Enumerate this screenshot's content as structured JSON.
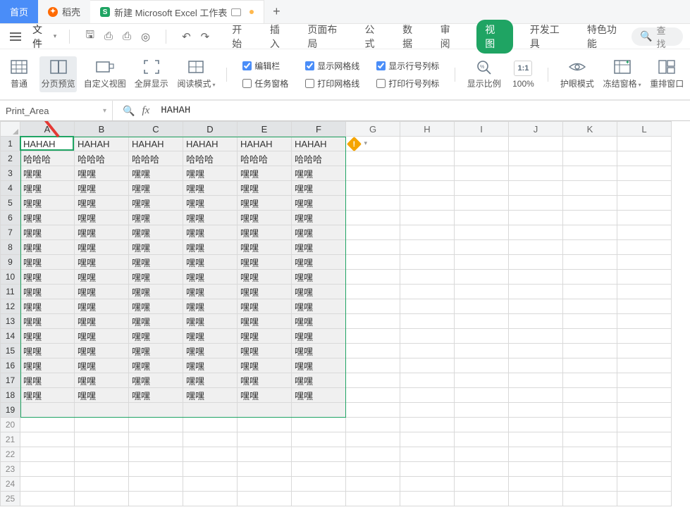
{
  "tabs": {
    "home": "首页",
    "daokke": "稻壳",
    "doc": "新建 Microsoft Excel 工作表"
  },
  "menubar": {
    "file": "文件",
    "search": "查找"
  },
  "menu": {
    "start": "开始",
    "insert": "插入",
    "pagelayout": "页面布局",
    "formula": "公式",
    "data": "数据",
    "review": "审阅",
    "view": "视图",
    "dev": "开发工具",
    "special": "特色功能"
  },
  "ribbon": {
    "normal": "普通",
    "pagebreak": "分页预览",
    "custom": "自定义视图",
    "fullscreen": "全屏显示",
    "readmode": "阅读模式",
    "checks": {
      "editbar": "编辑栏",
      "taskpane": "任务窗格",
      "gridlines": "显示网格线",
      "printgrid": "打印网格线",
      "headings": "显示行号列标",
      "printheadings": "打印行号列标"
    },
    "zoomratio": "显示比例",
    "pct": "100%",
    "eyecare": "护眼模式",
    "freeze": "冻结窗格",
    "arrange": "重排窗口"
  },
  "namebox": "Print_Area",
  "formula_value": "HAHAH",
  "columns": [
    "A",
    "B",
    "C",
    "D",
    "E",
    "F",
    "G",
    "H",
    "I",
    "J",
    "K",
    "L"
  ],
  "row_count": 25,
  "sel_cols": 6,
  "sel_rows": 19,
  "cells": {
    "row1": "HAHAH",
    "row2": "哈哈哈",
    "rest": "嘿嘿"
  }
}
